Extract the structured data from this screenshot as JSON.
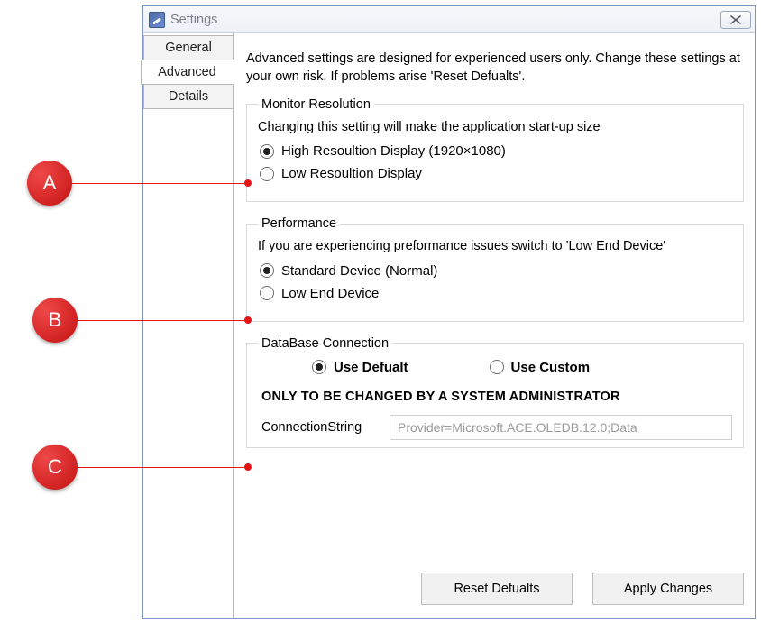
{
  "callouts": {
    "a": "A",
    "b": "B",
    "c": "C"
  },
  "window": {
    "title": "Settings"
  },
  "tabs": {
    "general": "General",
    "advanced": "Advanced",
    "details": "Details",
    "active": "advanced"
  },
  "intro": "Advanced settings are designed for experienced users only. Change these settings at your own risk. If problems arise 'Reset Defualts'.",
  "groups": {
    "monitor": {
      "legend": "Monitor Resolution",
      "desc": "Changing this setting will make the application start-up size",
      "opt_high": "High Resoultion Display (1920×1080)",
      "opt_low": "Low Resoultion Display",
      "selected": "high"
    },
    "performance": {
      "legend": "Performance",
      "desc": "If you are experiencing preformance issues switch to 'Low End Device'",
      "opt_standard": "Standard Device (Normal)",
      "opt_low": "Low End Device",
      "selected": "standard"
    },
    "db": {
      "legend": "DataBase Connection",
      "opt_default": "Use Defualt",
      "opt_custom": "Use Custom",
      "selected": "default",
      "warning": "ONLY TO BE CHANGED BY A SYSTEM ADMINISTRATOR",
      "cs_label": "ConnectionString",
      "cs_value": "Provider=Microsoft.ACE.OLEDB.12.0;Data"
    }
  },
  "buttons": {
    "reset": "Reset Defualts",
    "apply": "Apply Changes"
  }
}
